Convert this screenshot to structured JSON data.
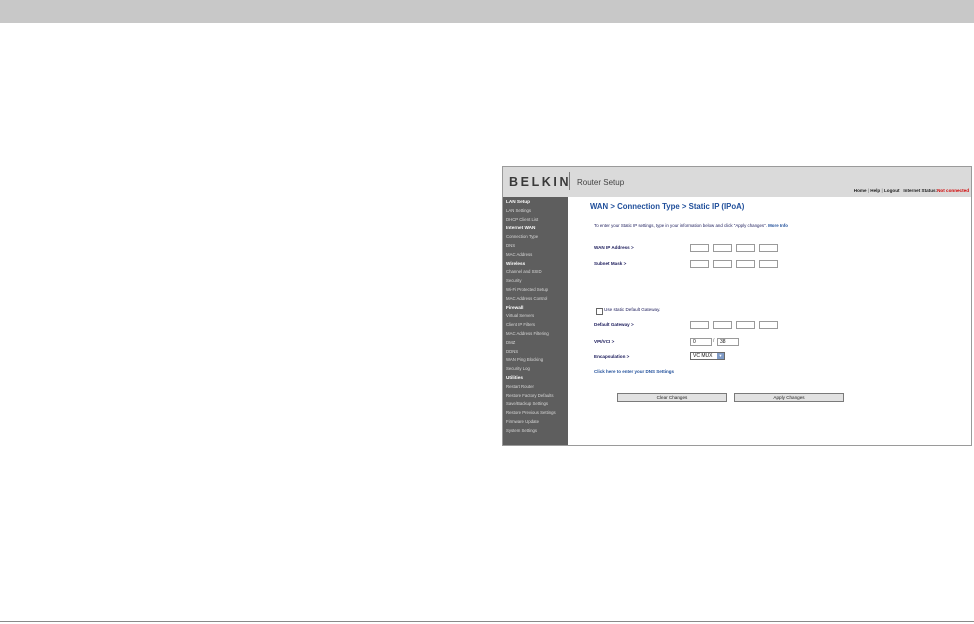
{
  "header": {
    "brand": "BELKIN",
    "app_title": "Router Setup",
    "nav": {
      "home": "Home",
      "help": "Help",
      "logout": "Logout",
      "internet_status_label": "Internet Status:",
      "internet_status_value": "Not connected"
    }
  },
  "sidebar": {
    "lan_setup": {
      "title": "LAN Setup",
      "items": [
        "LAN Settings",
        "DHCP Client List"
      ]
    },
    "internet_wan": {
      "title": "Internet WAN",
      "items": [
        "Connection Type",
        "DNS",
        "MAC Address"
      ]
    },
    "wireless": {
      "title": "Wireless",
      "items": [
        "Channel and SSID",
        "Security",
        "Wi-Fi Protected Setup",
        "MAC Address Control"
      ]
    },
    "firewall": {
      "title": "Firewall",
      "items": [
        "Virtual Servers",
        "Client IP Filters",
        "MAC Address Filtering",
        "DMZ",
        "DDNS",
        "WAN Ping Blocking",
        "Security Log"
      ]
    },
    "utilities": {
      "title": "Utilities",
      "items": [
        "Restart Router",
        "Restore Factory Defaults",
        "Save/Backup Settings",
        "Restore Previous Settings",
        "Firmware Update",
        "System Settings"
      ]
    }
  },
  "main": {
    "title": "WAN > Connection Type > Static IP (IPoA)",
    "intro": "To enter your Static IP settings, type in your information below and click \"Apply changes\".",
    "more_info": "More Info",
    "wan_ip_label": "WAN IP Address >",
    "subnet_mask_label": "Subnet Mask >",
    "use_gateway_label": "Use static Default Gateway.",
    "default_gateway_label": "Default Gateway >",
    "vpi_vci_label": "VPI/VCI >",
    "vpi_value": "0",
    "vci_value": "38",
    "vpi_sep": "/",
    "encapsulation_label": "Encapsulation >",
    "encapsulation_value": "VC MUX",
    "dns_link": "Click here to enter your DNS Settings",
    "clear_button": "Clear Changes",
    "apply_button": "Apply Changes"
  }
}
